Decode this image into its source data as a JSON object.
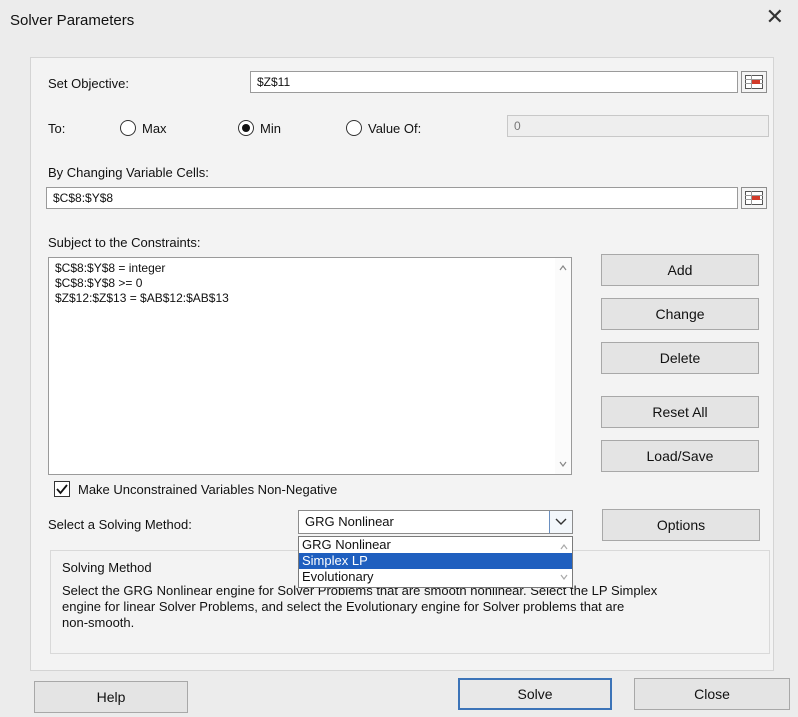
{
  "window": {
    "title": "Solver Parameters",
    "close_glyph": "✕"
  },
  "objective": {
    "label": "Set Objective:",
    "value": "$Z$11"
  },
  "to": {
    "label": "To:",
    "max_label": "Max",
    "min_label": "Min",
    "value_of_label": "Value Of:",
    "value_of_value": "0",
    "selected": "Min"
  },
  "changing_cells": {
    "label": "By Changing Variable Cells:",
    "value": "$C$8:$Y$8"
  },
  "constraints": {
    "label": "Subject to the Constraints:",
    "items": [
      "$C$8:$Y$8 = integer",
      "$C$8:$Y$8 >= 0",
      "$Z$12:$Z$13 = $AB$12:$AB$13"
    ]
  },
  "buttons": {
    "add": "Add",
    "change": "Change",
    "delete": "Delete",
    "reset_all": "Reset All",
    "load_save": "Load/Save",
    "options": "Options",
    "help": "Help",
    "solve": "Solve",
    "close": "Close"
  },
  "nonneg": {
    "label": "Make Unconstrained Variables Non-Negative",
    "checked": true
  },
  "method": {
    "label": "Select a Solving Method:",
    "selected": "GRG Nonlinear",
    "options": [
      "GRG Nonlinear",
      "Simplex LP",
      "Evolutionary"
    ],
    "highlighted": "Simplex LP"
  },
  "solving_method": {
    "title": "Solving Method",
    "line1": "Select the GRG Nonlinear engine for Solver Problems that are smooth nonlinear. Select the LP Simplex",
    "line2": "engine for linear Solver Problems, and select the Evolutionary engine for Solver problems that are",
    "line3": "non-smooth."
  },
  "colors": {
    "accent": "#1f5fbf",
    "default_button_border": "#3c74b8"
  }
}
